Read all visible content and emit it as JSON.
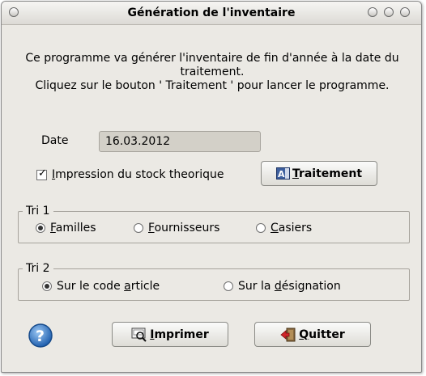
{
  "window": {
    "title": "Génération de l'inventaire"
  },
  "intro": {
    "line1": "Ce programme va générer l'inventaire de fin d'année à la date du traitement.",
    "line2": "Cliquez sur le bouton ' Traitement ' pour lancer le programme."
  },
  "form": {
    "date_label": "Date",
    "date_value": "16.03.2012",
    "stock_checkbox": {
      "checked": true,
      "label_first": "I",
      "label_rest": "mpression du stock theorique"
    },
    "traitement_button": {
      "mnemonic": "T",
      "rest": "raitement",
      "icon": "form-letter-a-icon"
    }
  },
  "tri1": {
    "legend": "Tri 1",
    "options": [
      {
        "mnemonic": "F",
        "rest": "amilles",
        "selected": true
      },
      {
        "mnemonic": "F",
        "rest": "ournisseurs",
        "selected": false
      },
      {
        "mnemonic": "C",
        "rest": "asiers",
        "selected": false
      }
    ]
  },
  "tri2": {
    "legend": "Tri 2",
    "options": [
      {
        "before": "Sur le code ",
        "mnemonic": "a",
        "after": "rticle",
        "selected": true
      },
      {
        "before": "Sur la ",
        "mnemonic": "d",
        "after": "ésignation",
        "selected": false
      }
    ]
  },
  "footer": {
    "help_icon": "help-icon",
    "print_button": {
      "mnemonic": "I",
      "rest": "mprimer",
      "icon": "print-preview-icon"
    },
    "quit_button": {
      "mnemonic": "Q",
      "rest": "uitter",
      "icon": "exit-door-icon"
    }
  },
  "colors": {
    "window_bg": "#ebe9e4",
    "disabled_input_bg": "#d3d0c8"
  }
}
